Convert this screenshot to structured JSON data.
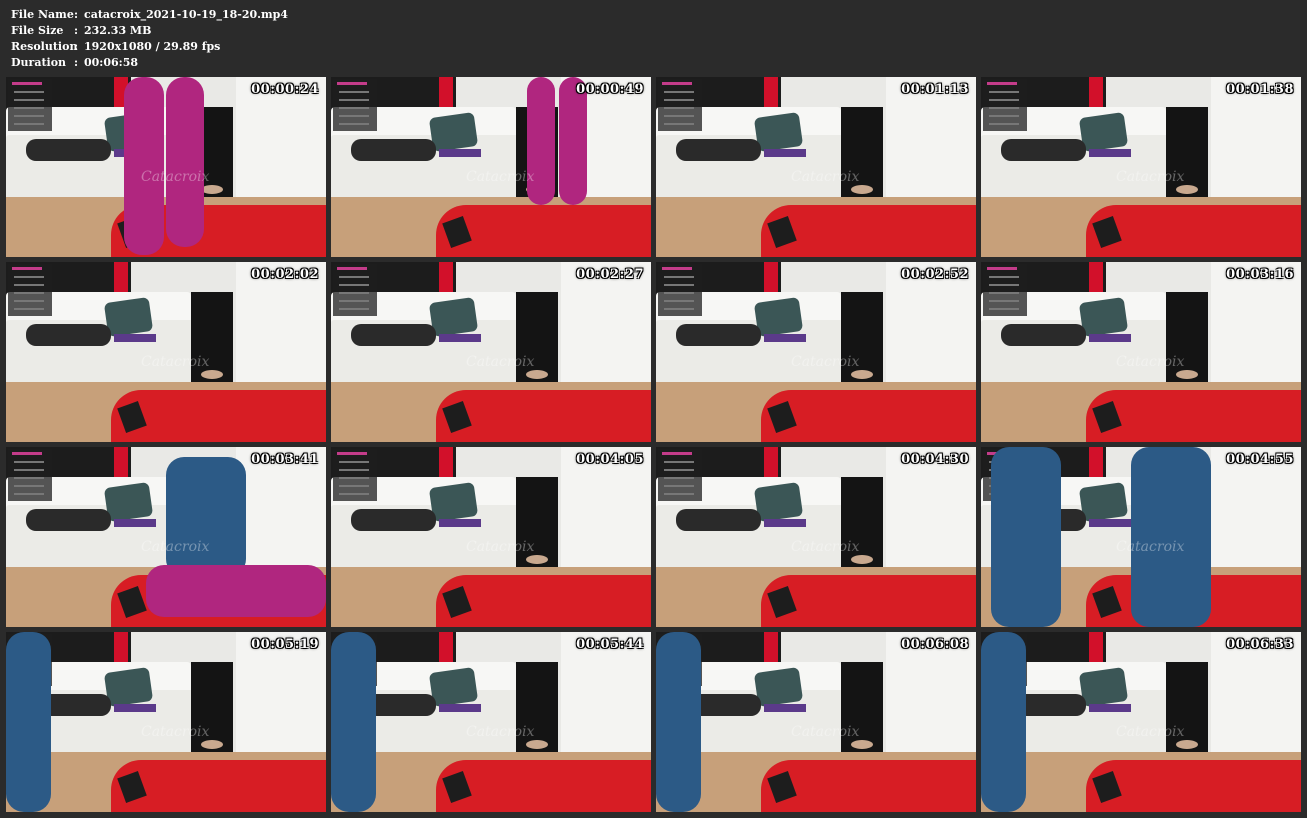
{
  "file_info": {
    "name_label": "File Name",
    "name_value": "catacroix_2021-10-19_18-20.mp4",
    "size_label": "File Size",
    "size_value": "232.33 MB",
    "resolution_label": "Resolution",
    "resolution_value": "1920x1080 / 29.89 fps",
    "duration_label": "Duration",
    "duration_value": "00:06:58",
    "separator": ":"
  },
  "thumbnails": [
    {
      "timestamp": "00:00:24",
      "figure": "boots-near"
    },
    {
      "timestamp": "00:00:49",
      "figure": "boots-far"
    },
    {
      "timestamp": "00:01:13",
      "figure": "none"
    },
    {
      "timestamp": "00:01:38",
      "figure": "none"
    },
    {
      "timestamp": "00:02:02",
      "figure": "none"
    },
    {
      "timestamp": "00:02:27",
      "figure": "none"
    },
    {
      "timestamp": "00:02:52",
      "figure": "none"
    },
    {
      "timestamp": "00:03:16",
      "figure": "none"
    },
    {
      "timestamp": "00:03:41",
      "figure": "seated"
    },
    {
      "timestamp": "00:04:05",
      "figure": "none"
    },
    {
      "timestamp": "00:04:30",
      "figure": "none"
    },
    {
      "timestamp": "00:04:55",
      "figure": "legs-blue"
    },
    {
      "timestamp": "00:05:19",
      "figure": "legs-blue-left"
    },
    {
      "timestamp": "00:05:44",
      "figure": "legs-blue-left"
    },
    {
      "timestamp": "00:06:08",
      "figure": "legs-blue-left"
    },
    {
      "timestamp": "00:06:33",
      "figure": "legs-blue-left"
    }
  ],
  "watermark_text": "Catacroix",
  "colors": {
    "background": "#2b2b2b",
    "text": "#ffffff",
    "carpet": "#d71d24",
    "latex_purple": "#b0267f",
    "latex_blue": "#2c5a86"
  }
}
